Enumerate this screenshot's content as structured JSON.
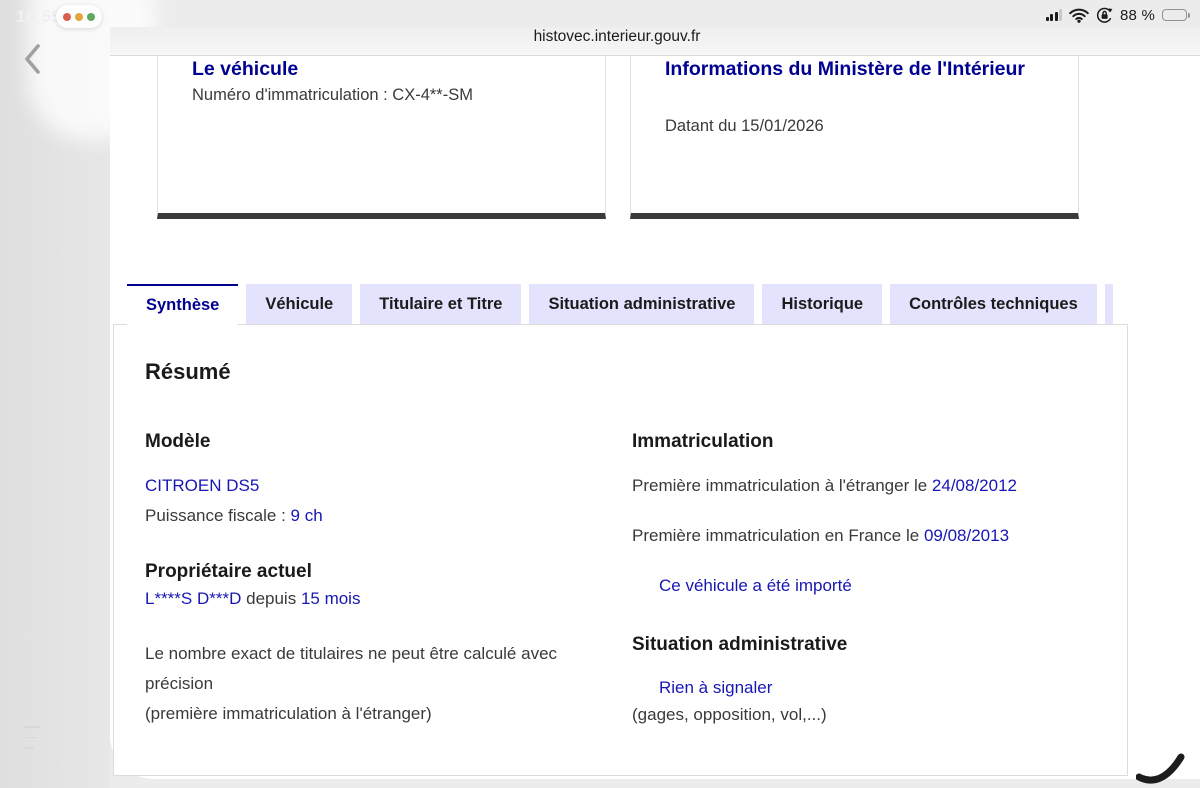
{
  "status_bar": {
    "time": "10:55",
    "battery_percent": "88 %",
    "window_controls": [
      "close",
      "minimize",
      "zoom"
    ]
  },
  "browser": {
    "url": "histovec.interieur.gouv.fr"
  },
  "cards": {
    "vehicle": {
      "title": "Le véhicule",
      "line": "Numéro d'immatriculation : CX-4**-SM"
    },
    "ministry": {
      "title": "Informations du Ministère de l'Intérieur",
      "line": "Datant du 15/01/2026"
    }
  },
  "tabs": [
    {
      "label": "Synthèse",
      "active": true
    },
    {
      "label": "Véhicule",
      "active": false
    },
    {
      "label": "Titulaire et Titre",
      "active": false
    },
    {
      "label": "Situation administrative",
      "active": false
    },
    {
      "label": "Historique",
      "active": false
    },
    {
      "label": "Contrôles techniques",
      "active": false
    }
  ],
  "summary": {
    "title": "Résumé",
    "model": {
      "heading": "Modèle",
      "name": "CITROEN DS5",
      "power_label": "Puissance fiscale : ",
      "power_value": "9 ch"
    },
    "owner": {
      "heading": "Propriétaire actuel",
      "name": "L****S D***D",
      "mid": " depuis ",
      "duration": "15 mois",
      "note_line1": "Le nombre exact de titulaires ne peut être calculé avec précision",
      "note_line2": "(première immatriculation à l'étranger)"
    },
    "registration": {
      "heading": "Immatriculation",
      "abroad_label": "Première immatriculation à l'étranger le ",
      "abroad_date": "24/08/2012",
      "france_label": "Première immatriculation en France le ",
      "france_date": "09/08/2013",
      "imported": "Ce véhicule a été importé"
    },
    "admin": {
      "heading": "Situation administrative",
      "status": "Rien à signaler",
      "note": "(gages, opposition, vol,...)"
    }
  },
  "colors": {
    "accent_blue": "#000091",
    "link_blue": "#1717b3",
    "tab_inactive_bg": "#e3e3fd",
    "body_gray": "#3a3a3a",
    "card_bottom_bar": "#3a3a3a"
  }
}
